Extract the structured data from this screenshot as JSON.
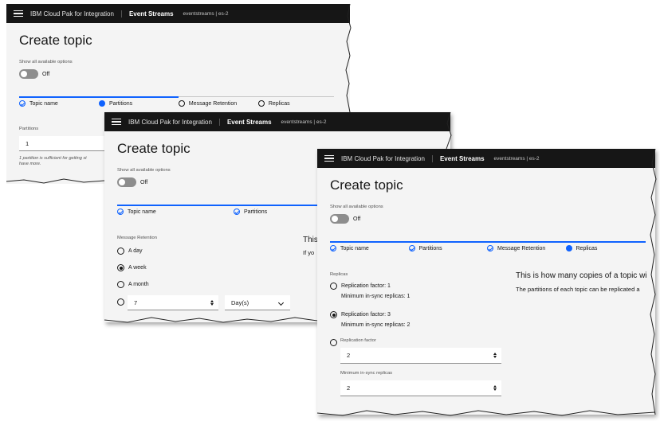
{
  "header": {
    "product": "IBM Cloud Pak for Integration",
    "service": "Event Streams",
    "instance": "eventstreams | es-2"
  },
  "page": {
    "title": "Create topic",
    "show_options_label": "Show all available options",
    "toggle_state": "Off"
  },
  "steps": {
    "topic_name": "Topic name",
    "partitions": "Partitions",
    "message_retention": "Message Retention",
    "replicas": "Replicas"
  },
  "panel1": {
    "field_label": "Partitions",
    "value": "1",
    "helper_line1": "1 partition is sufficient for getting st",
    "helper_line2": "have more."
  },
  "panel2": {
    "field_label": "Message Retention",
    "options": [
      "A day",
      "A week",
      "A month"
    ],
    "selected": "A week",
    "custom_value": "7",
    "unit": "Day(s)",
    "desc_title": "This",
    "desc_text": "If yo"
  },
  "panel3": {
    "field_label": "Replicas",
    "option1_label": "Replication factor: 1",
    "option1_sub": "Minimum in-sync replicas: 1",
    "option2_label": "Replication factor: 3",
    "option2_sub": "Minimum in-sync replicas: 2",
    "custom_factor_label": "Replication factor",
    "custom_factor_value": "2",
    "min_insync_label": "Minimum in-sync replicas",
    "min_insync_value": "2",
    "desc_title": "This is how many copies of a topic wi",
    "desc_text": "The partitions of each topic can be replicated a"
  }
}
